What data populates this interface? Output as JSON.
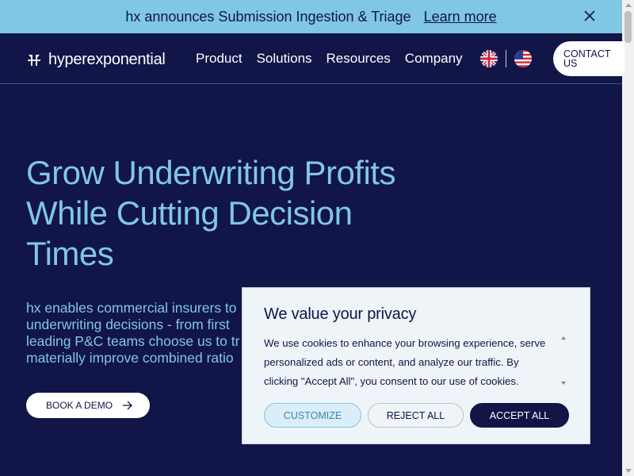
{
  "announcement": {
    "message": "hx announces Submission Ingestion & Triage",
    "link_label": "Learn more"
  },
  "nav": {
    "logo_text": "hyperexponential",
    "menu": [
      {
        "label": "Product"
      },
      {
        "label": "Solutions"
      },
      {
        "label": "Resources"
      },
      {
        "label": "Company"
      }
    ],
    "contact_label_line1": "CONTACT",
    "contact_label_line2": "US"
  },
  "hero": {
    "title_line1": "Grow Underwriting Profits",
    "title_line2": "While Cutting Decision",
    "title_line3": "Times",
    "body_line1": "hx enables commercial insurers to",
    "body_line2": "underwriting decisions - from first",
    "body_line3": "leading P&C teams choose us to tr",
    "body_line4": "materially improve combined ratio",
    "cta_label": "BOOK A DEMO"
  },
  "cookie": {
    "title": "We value your privacy",
    "text_line1": "We use cookies to enhance your browsing experience, serve",
    "text_line2": "personalized ads or content, and analyze our traffic. By",
    "text_line3": "clicking \"Accept All\", you consent to our use of cookies.",
    "customize_label": "CUSTOMIZE",
    "reject_label": "REJECT ALL",
    "accept_label": "ACCEPT ALL"
  },
  "colors": {
    "navy": "#111547",
    "light_blue": "#80c7e3",
    "modal_bg": "#eef4f7"
  },
  "icons": {
    "close": "close-icon",
    "arrow": "arrow-right-icon",
    "uk_flag": "uk-flag-icon",
    "us_flag": "us-flag-icon",
    "logo": "hx-logo-icon"
  }
}
